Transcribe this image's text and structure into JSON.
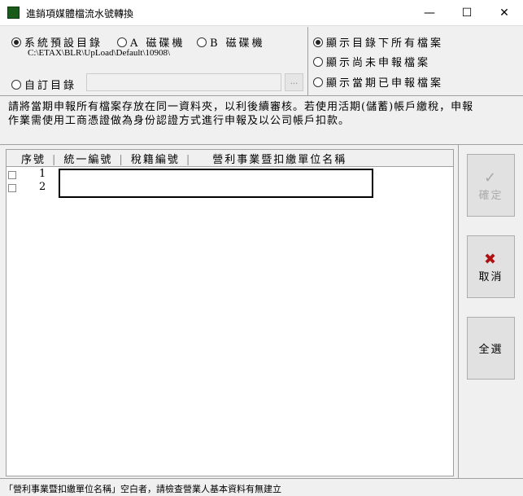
{
  "window": {
    "title": "進銷項媒體檔流水號轉換",
    "minimize": "—",
    "maximize": "☐",
    "close": "✕"
  },
  "directory": {
    "system_default": "系統預設目錄",
    "drive_a": "A 磁碟機",
    "drive_b": "B 磁碟機",
    "path": "C:\\ETAX\\BLR\\UpLoad\\Default\\10908\\",
    "custom": "自訂目錄",
    "custom_value": "",
    "browse": "..."
  },
  "filter": {
    "all": "顯示目錄下所有檔案",
    "unreported": "顯示尚未申報檔案",
    "reported": "顯示當期已申報檔案"
  },
  "info": "請將當期申報所有檔案存放在同一資料夾，以利後續審核。若使用活期(儲蓄)帳戶繳稅，申報作業需使用工商憑證做為身份認證方式進行申報及以公司帳戶扣款。",
  "table": {
    "columns": [
      "序號",
      "統一編號",
      "稅籍編號",
      "營利事業暨扣繳單位名稱"
    ],
    "rows": [
      {
        "seq": "1"
      },
      {
        "seq": "2"
      }
    ]
  },
  "buttons": {
    "confirm": "確定",
    "cancel": "取消",
    "select_all": "全選"
  },
  "status": "「營利事業暨扣繳單位名稱」空白者，請檢查營業人基本資料有無建立"
}
